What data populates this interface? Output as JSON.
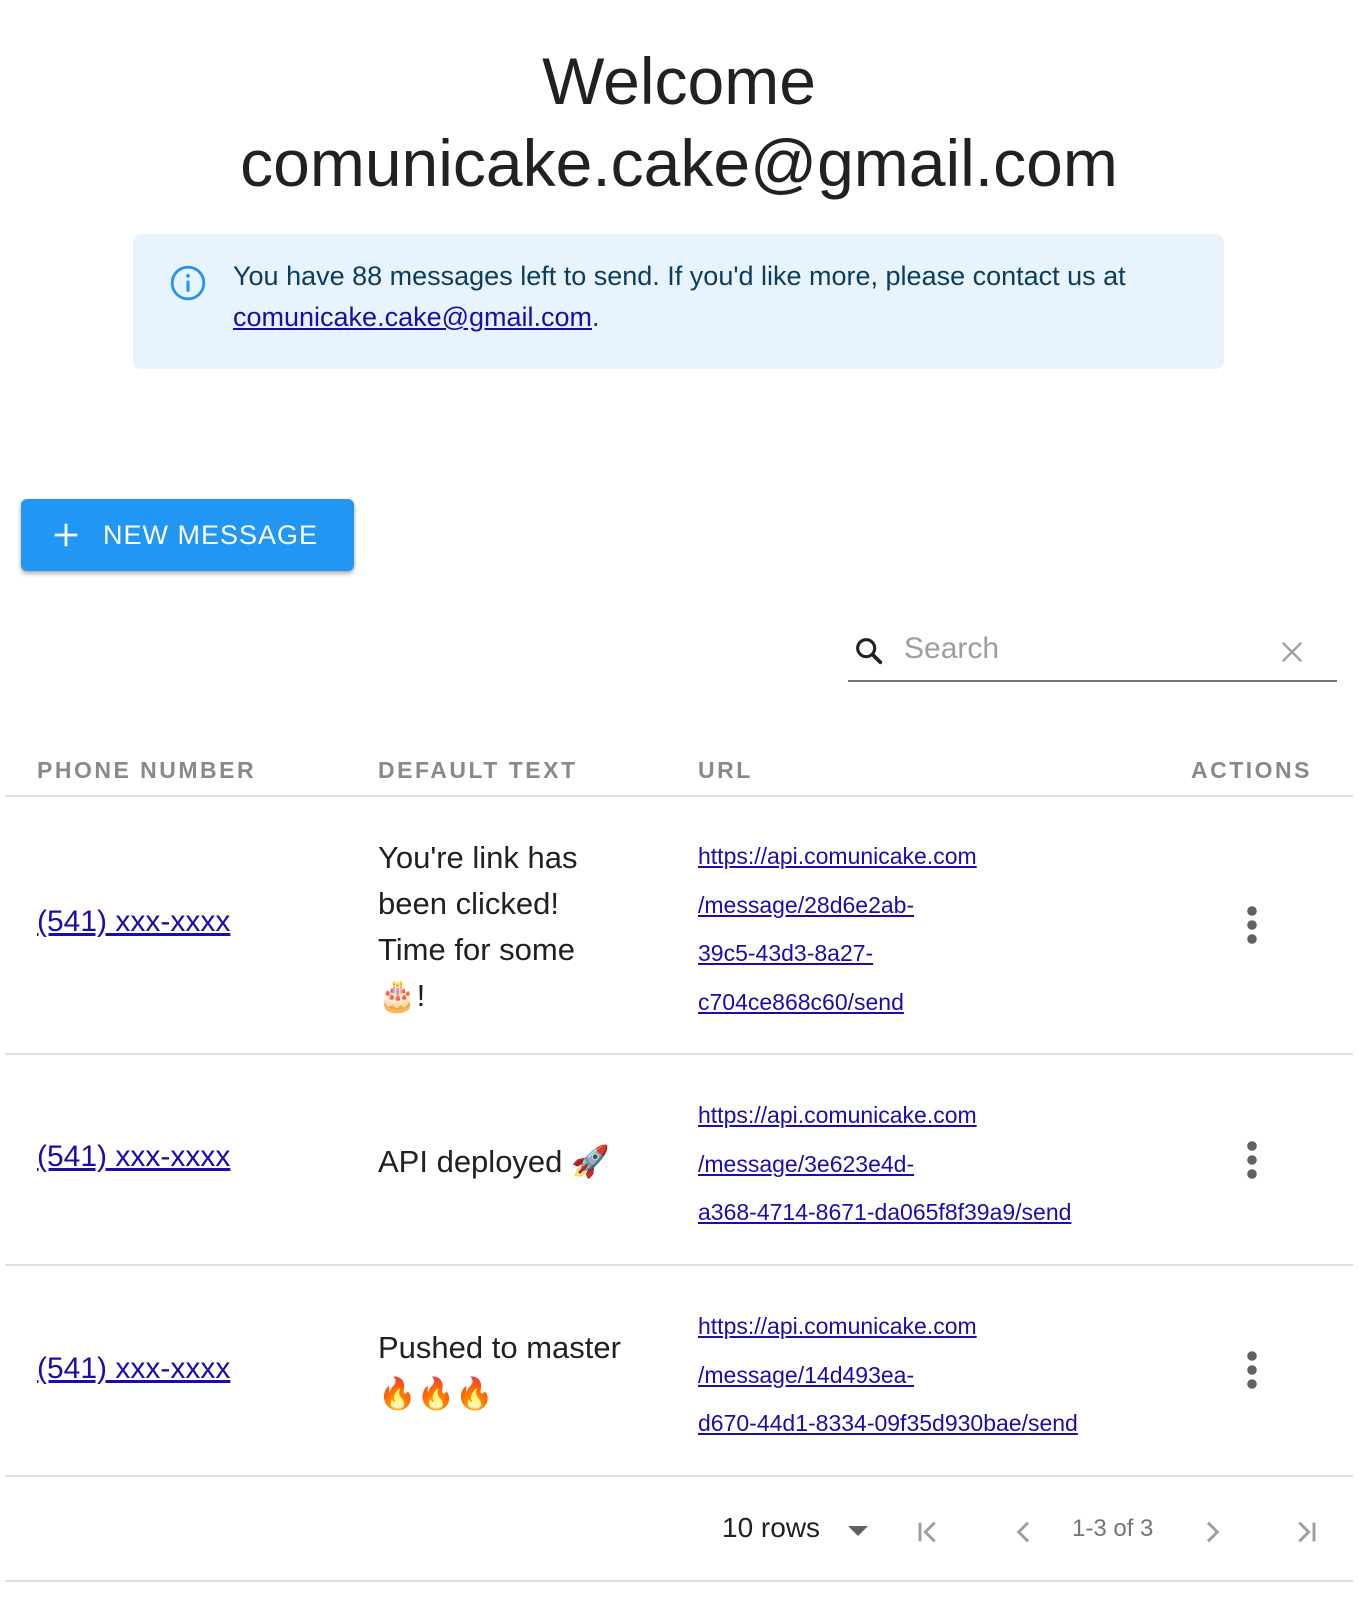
{
  "header": {
    "title_line1": "Welcome",
    "title_line2": "comunicake.cake@gmail.com"
  },
  "alert": {
    "icon": "info-icon",
    "text": "You have 88 messages left to send. If you'd like more, please contact us at",
    "email_link": "comunicake.cake@gmail.com",
    "suffix": "."
  },
  "new_message_button": {
    "icon": "plus-icon",
    "label": "NEW MESSAGE"
  },
  "search": {
    "placeholder": "Search",
    "value": ""
  },
  "table": {
    "columns": [
      "PHONE NUMBER",
      "DEFAULT TEXT",
      "URL",
      "ACTIONS"
    ],
    "rows": [
      {
        "phone": "(541) xxx-xxxx",
        "text": "You're link has been clicked! Time for some 🎂!",
        "url_lines": [
          "https://api.comunicake.com",
          "/message/28d6e2ab-",
          "39c5-43d3-8a27-",
          "c704ce868c60/send"
        ]
      },
      {
        "phone": "(541) xxx-xxxx",
        "text": "API deployed 🚀",
        "url_lines": [
          "https://api.comunicake.com",
          "/message/3e623e4d-",
          "a368-4714-8671-da065f8f39a9/send"
        ]
      },
      {
        "phone": "(541) xxx-xxxx",
        "text": "Pushed to master 🔥🔥🔥",
        "url_lines": [
          "https://api.comunicake.com",
          "/message/14d493ea-",
          "d670-44d1-8334-09f35d930bae/send"
        ]
      }
    ]
  },
  "pagination": {
    "rows_label": "10 rows",
    "range": "1-3 of 3"
  },
  "colors": {
    "primary": "#2196f3",
    "alert_bg": "#e8f4fd",
    "alert_text": "#0d3c61",
    "link": "#1a0dab"
  }
}
